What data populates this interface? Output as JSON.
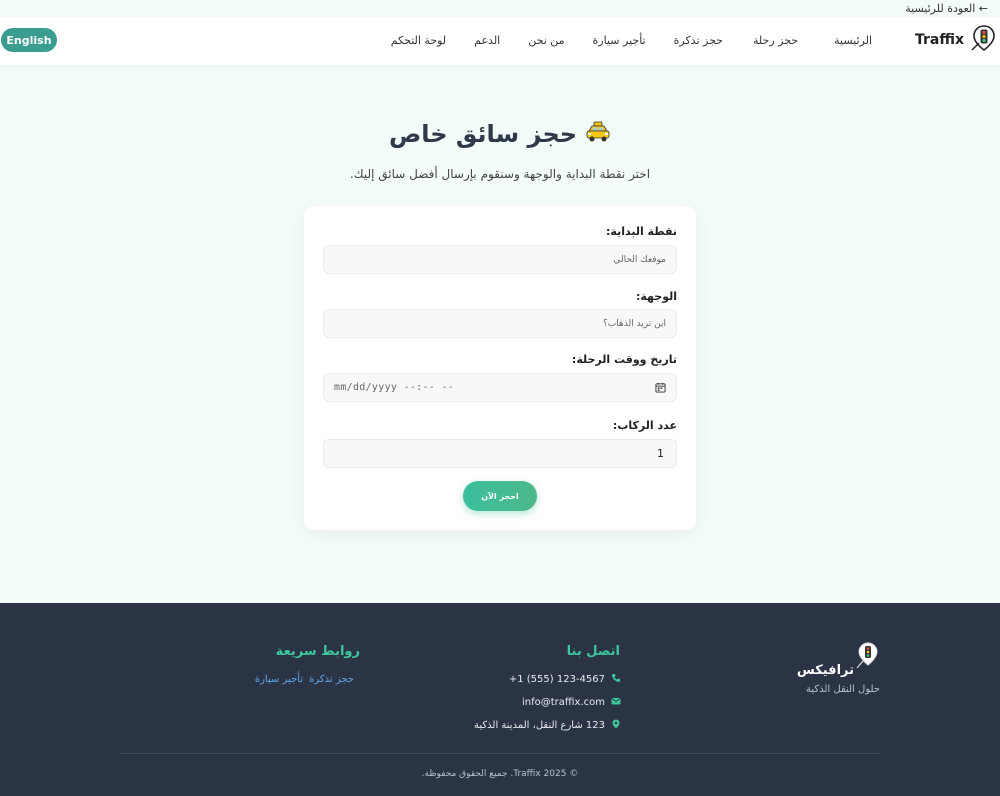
{
  "back_link": "← العودة للرئيسية",
  "brand": {
    "name": "Traffix"
  },
  "nav": {
    "items": [
      {
        "label": "الرئيسية"
      },
      {
        "label": "حجز رحلة"
      },
      {
        "label": "حجز تذكرة"
      },
      {
        "label": "تأجير سيارة"
      },
      {
        "label": "من نحن"
      },
      {
        "label": "الدعم"
      },
      {
        "label": "لوحة التحكم"
      }
    ],
    "language_button": "English"
  },
  "hero": {
    "title": "حجز سائق خاص",
    "title_icon": "taxi-emoji",
    "subtitle": "اختر نقطة البداية والوجهة وسنقوم بإرسال أفضل سائق إليك."
  },
  "form": {
    "start": {
      "label": "نقطة البداية:",
      "placeholder": "موقعك الحالي"
    },
    "destination": {
      "label": "الوجهة:",
      "placeholder": "أين تريد الذهاب؟"
    },
    "datetime": {
      "label": "تاريخ ووقت الرحلة:",
      "placeholder": "mm/dd/yyyy --:-- --"
    },
    "passengers": {
      "label": "عدد الركاب:",
      "value": "1"
    },
    "submit_label": "احجز الآن"
  },
  "footer": {
    "brand_name": "ترافيكس",
    "tagline": "حلول النقل الذكية",
    "contact": {
      "title": "اتصل بنا",
      "phone": "+1 (555) 123-4567",
      "email": "info@traffix.com",
      "address": "123 شارع النقل، المدينة الذكية"
    },
    "quick_links": {
      "title": "روابط سريعة",
      "items": [
        {
          "label": "حجز تذكرة"
        },
        {
          "label": "تأجير سيارة"
        }
      ]
    },
    "copyright": "© Traffix 2025. جميع الحقوق محفوظة."
  },
  "colors": {
    "accent": "#3a9d8f",
    "footer_bg": "#2b3445",
    "footer_heading": "#3cc79c",
    "link": "#5fa8e8",
    "page_bg": "#f4fcf9"
  }
}
